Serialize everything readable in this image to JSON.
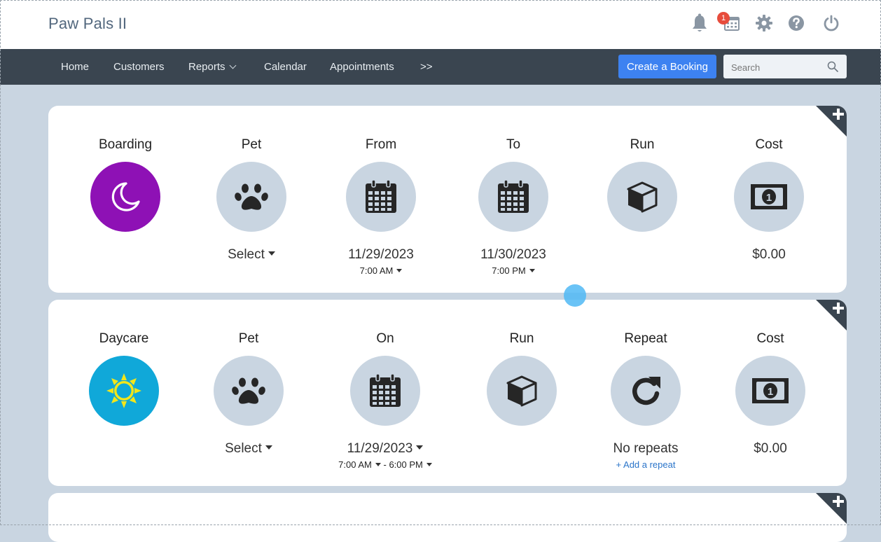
{
  "app": {
    "title": "Paw Pals II"
  },
  "header": {
    "notification_count": "1"
  },
  "nav": {
    "items": [
      "Home",
      "Customers",
      "Reports",
      "Calendar",
      "Appointments",
      ">>"
    ],
    "create_booking": "Create a Booking",
    "search_placeholder": "Search"
  },
  "boarding": {
    "type_label": "Boarding",
    "pet_label": "Pet",
    "pet_value": "Select",
    "from_label": "From",
    "from_date": "11/29/2023",
    "from_time": "7:00 AM",
    "to_label": "To",
    "to_date": "11/30/2023",
    "to_time": "7:00 PM",
    "run_label": "Run",
    "cost_label": "Cost",
    "cost_value": "$0.00"
  },
  "daycare": {
    "type_label": "Daycare",
    "pet_label": "Pet",
    "pet_value": "Select",
    "on_label": "On",
    "on_date": "11/29/2023",
    "start_time": "7:00 AM",
    "time_separator": "-",
    "end_time": "6:00 PM",
    "run_label": "Run",
    "repeat_label": "Repeat",
    "repeat_value": "No repeats",
    "add_repeat": "+ Add a repeat",
    "cost_label": "Cost",
    "cost_value": "$0.00"
  },
  "colors": {
    "boarding_accent": "#8e11b5",
    "daycare_accent": "#10a8d9",
    "primary_button": "#3d82f1",
    "navbar": "#3a4550",
    "page_background": "#c9d5e1",
    "badge": "#e74c3c"
  },
  "icons": {
    "boarding": "moon-icon",
    "daycare": "sun-icon",
    "pet": "paw-icon",
    "date": "calendar-icon",
    "run": "box-icon",
    "repeat": "redo-icon",
    "cost": "money-icon"
  }
}
